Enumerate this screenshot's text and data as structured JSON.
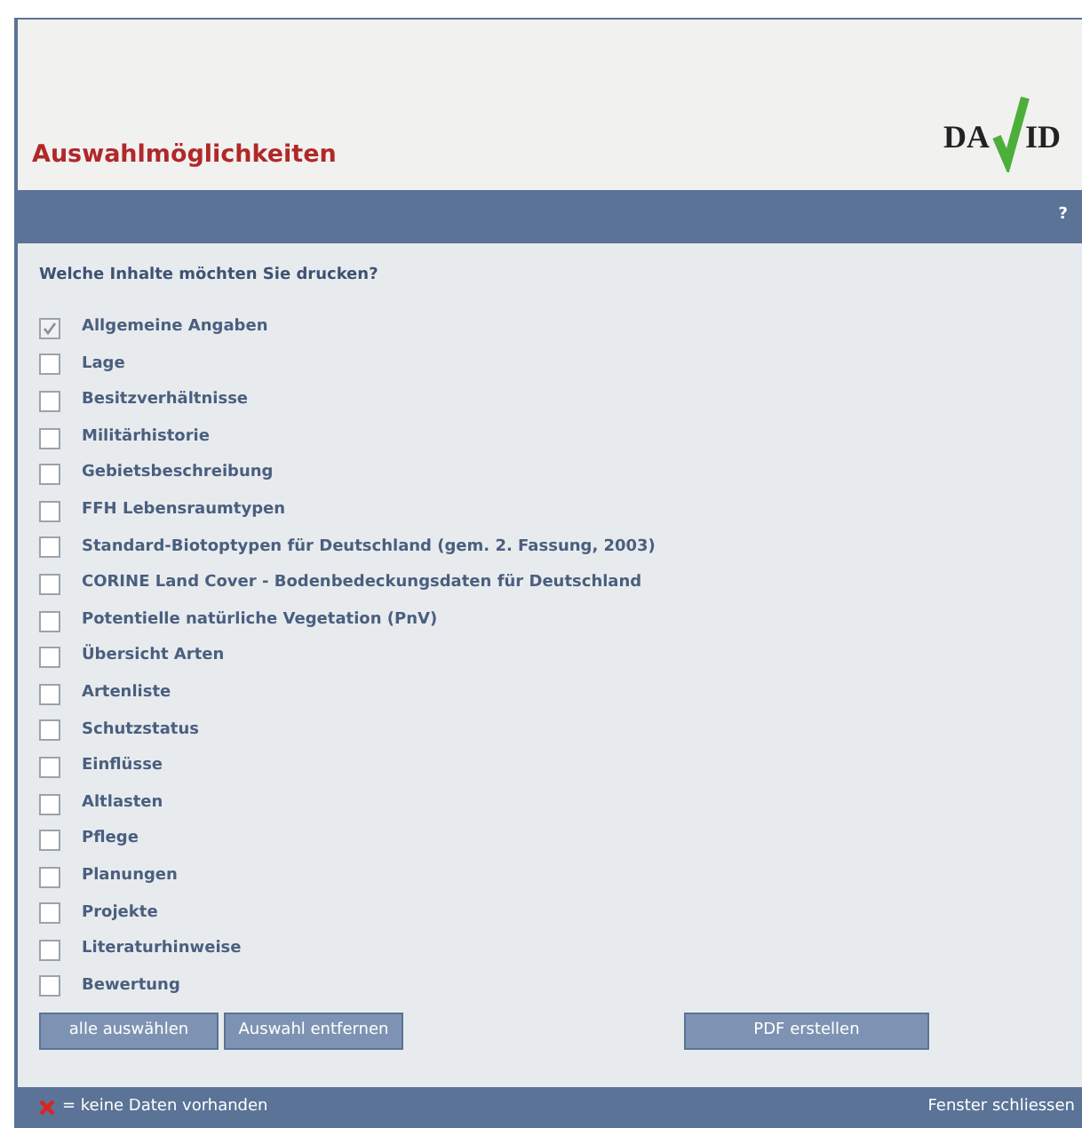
{
  "header": {
    "title": "Auswahlmöglichkeiten",
    "logo": {
      "left": "DA",
      "right": "ID"
    }
  },
  "toolbar": {
    "help": "?"
  },
  "question": "Welche Inhalte möchten Sie drucken?",
  "options": [
    {
      "label": "Allgemeine Angaben",
      "checked": true
    },
    {
      "label": "Lage",
      "checked": false
    },
    {
      "label": "Besitzverhältnisse",
      "checked": false
    },
    {
      "label": "Militärhistorie",
      "checked": false
    },
    {
      "label": "Gebietsbeschreibung",
      "checked": false
    },
    {
      "label": "FFH Lebensraumtypen",
      "checked": false
    },
    {
      "label": "Standard-Biotoptypen für Deutschland (gem. 2. Fassung, 2003)",
      "checked": false
    },
    {
      "label": "CORINE Land Cover - Bodenbedeckungsdaten für Deutschland",
      "checked": false
    },
    {
      "label": "Potentielle natürliche Vegetation (PnV)",
      "checked": false
    },
    {
      "label": "Übersicht Arten",
      "checked": false
    },
    {
      "label": "Artenliste",
      "checked": false
    },
    {
      "label": "Schutzstatus",
      "checked": false
    },
    {
      "label": "Einflüsse",
      "checked": false
    },
    {
      "label": "Altlasten",
      "checked": false
    },
    {
      "label": "Pflege",
      "checked": false
    },
    {
      "label": "Planungen",
      "checked": false
    },
    {
      "label": "Projekte",
      "checked": false
    },
    {
      "label": "Literaturhinweise",
      "checked": false
    },
    {
      "label": "Bewertung",
      "checked": false
    }
  ],
  "buttons": {
    "select_all": "alle auswählen",
    "clear": "Auswahl entfernen",
    "pdf": "PDF erstellen"
  },
  "footer": {
    "legend": "= keine Daten vorhanden",
    "close": "Fenster schliessen"
  }
}
